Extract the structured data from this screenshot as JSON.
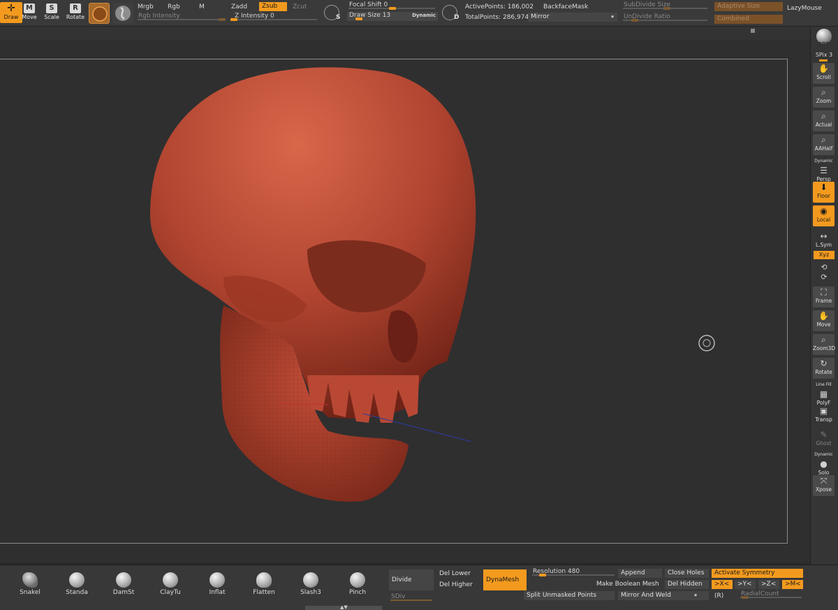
{
  "toolbar": {
    "tools": [
      {
        "label": "Draw",
        "icon": "draw-icon",
        "active": true
      },
      {
        "label": "Move",
        "icon": "M",
        "active": false
      },
      {
        "label": "Scale",
        "icon": "S",
        "active": false
      },
      {
        "label": "Rotate",
        "icon": "R",
        "active": false
      }
    ],
    "mrgb": "Mrgb",
    "rgb": "Rgb",
    "m": "M",
    "zadd": "Zadd",
    "zsub": "Zsub",
    "zcut": "Zcut",
    "rgb_intensity": "Rgb Intensity",
    "z_intensity": "Z Intensity 0",
    "focal_shift": "Focal Shift 0",
    "draw_size": "Draw Size 13",
    "dynamic": "Dynamic",
    "s_key": "S",
    "d_key": "D",
    "active_points": "ActivePoints: 186,002",
    "total_points": "TotalPoints: 286,974",
    "backface_mask": "BackfaceMask",
    "mirror": "Mirror",
    "subdivide_size": "SubDivide Size",
    "undivide_ratio": "UnDivide Ratio",
    "adaptive_size": "Adaptive Size",
    "combined": "Combined",
    "lazy_mouse": "LazyMouse"
  },
  "shelf": [
    {
      "label": "BPR",
      "icon": "bpr-sphere-icon",
      "state": "normal"
    },
    {
      "label": "Scroll",
      "icon": "scroll-hand-icon",
      "state": "normal"
    },
    {
      "label": "Zoom",
      "icon": "zoom-icon",
      "state": "normal"
    },
    {
      "label": "Actual",
      "icon": "actual-size-icon",
      "state": "normal"
    },
    {
      "label": "AAHalf",
      "icon": "aahalf-icon",
      "state": "normal"
    },
    {
      "label": "Persp",
      "icon": "perspective-icon",
      "state": "normal"
    },
    {
      "label": "Floor",
      "icon": "floor-icon",
      "state": "on"
    },
    {
      "label": "Local",
      "icon": "local-icon",
      "state": "on"
    },
    {
      "label": "L.Sym",
      "icon": "lsym-icon",
      "state": "normal"
    },
    {
      "label": "Frame",
      "icon": "frame-icon",
      "state": "normal"
    },
    {
      "label": "Move",
      "icon": "move-hand-icon",
      "state": "normal"
    },
    {
      "label": "Zoom3D",
      "icon": "zoom3d-icon",
      "state": "normal"
    },
    {
      "label": "Rotate",
      "icon": "rotate-icon",
      "state": "normal"
    },
    {
      "label": "PolyF",
      "icon": "polyframe-icon",
      "state": "normal"
    },
    {
      "label": "Transp",
      "icon": "transparency-icon",
      "state": "normal"
    },
    {
      "label": "Ghost",
      "icon": "ghost-icon",
      "state": "off"
    },
    {
      "label": "Solo",
      "icon": "solo-icon",
      "state": "normal"
    },
    {
      "label": "Xpose",
      "icon": "xpose-icon",
      "state": "normal"
    }
  ],
  "shelf_extra": {
    "spix": "SPix 3",
    "xyz": "Xyz",
    "dynamic": "Dynamic",
    "line": "Line Fill"
  },
  "brushes": [
    {
      "name": "Snakel"
    },
    {
      "name": "Standa"
    },
    {
      "name": "DamSt"
    },
    {
      "name": "ClayTu"
    },
    {
      "name": "Inflat"
    },
    {
      "name": "Flatten"
    },
    {
      "name": "Slash3"
    },
    {
      "name": "Pinch"
    }
  ],
  "geometry": {
    "divide": "Divide",
    "del_lower": "Del Lower",
    "del_higher": "Del Higher",
    "sdiv": "SDiv",
    "dynamesh": "DynaMesh",
    "resolution": "Resolution 480",
    "make_boolean": "Make Boolean Mesh",
    "split_unmasked": "Split Unmasked Points",
    "append": "Append",
    "mirror_weld": "Mirror And Weld",
    "close_holes": "Close Holes",
    "del_hidden": "Del Hidden",
    "activate_symmetry": "Activate Symmetry",
    "x": ">X<",
    "y": ">Y<",
    "z": ">Z<",
    "m": ">M<",
    "r": "(R)",
    "radial_count": "RadialCount"
  },
  "colors": {
    "accent": "#f39a1e",
    "mesh": "#b5452f",
    "background": "#2f2f2f"
  }
}
